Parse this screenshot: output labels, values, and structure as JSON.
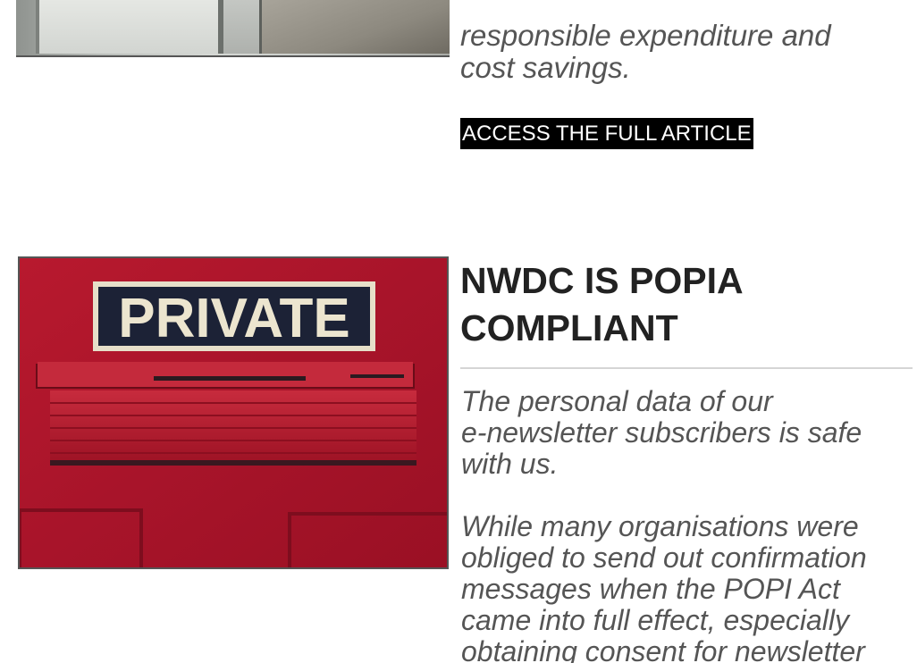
{
  "top_article": {
    "text_lines": [
      "responsible expenditure and",
      "cost savings."
    ],
    "button_label": "ACCESS THE FULL ARTICLE"
  },
  "popia_article": {
    "image_sign_text": "PRIVATE",
    "title_lines": [
      "NWDC IS POPIA",
      "COMPLIANT"
    ],
    "intro_lines": [
      "The personal data of our",
      "e-newsletter subscribers is safe",
      "with us."
    ],
    "body_lines": [
      "While many organisations were",
      "obliged to send out confirmation",
      "messages when the POPI Act",
      "came into full effect, especially",
      "obtaining consent for newsletter"
    ]
  },
  "colors": {
    "door_red": "#b0182c",
    "sign_navy": "#1c2236",
    "button_bg": "#000000",
    "body_text": "#555555",
    "title_text": "#222222"
  }
}
